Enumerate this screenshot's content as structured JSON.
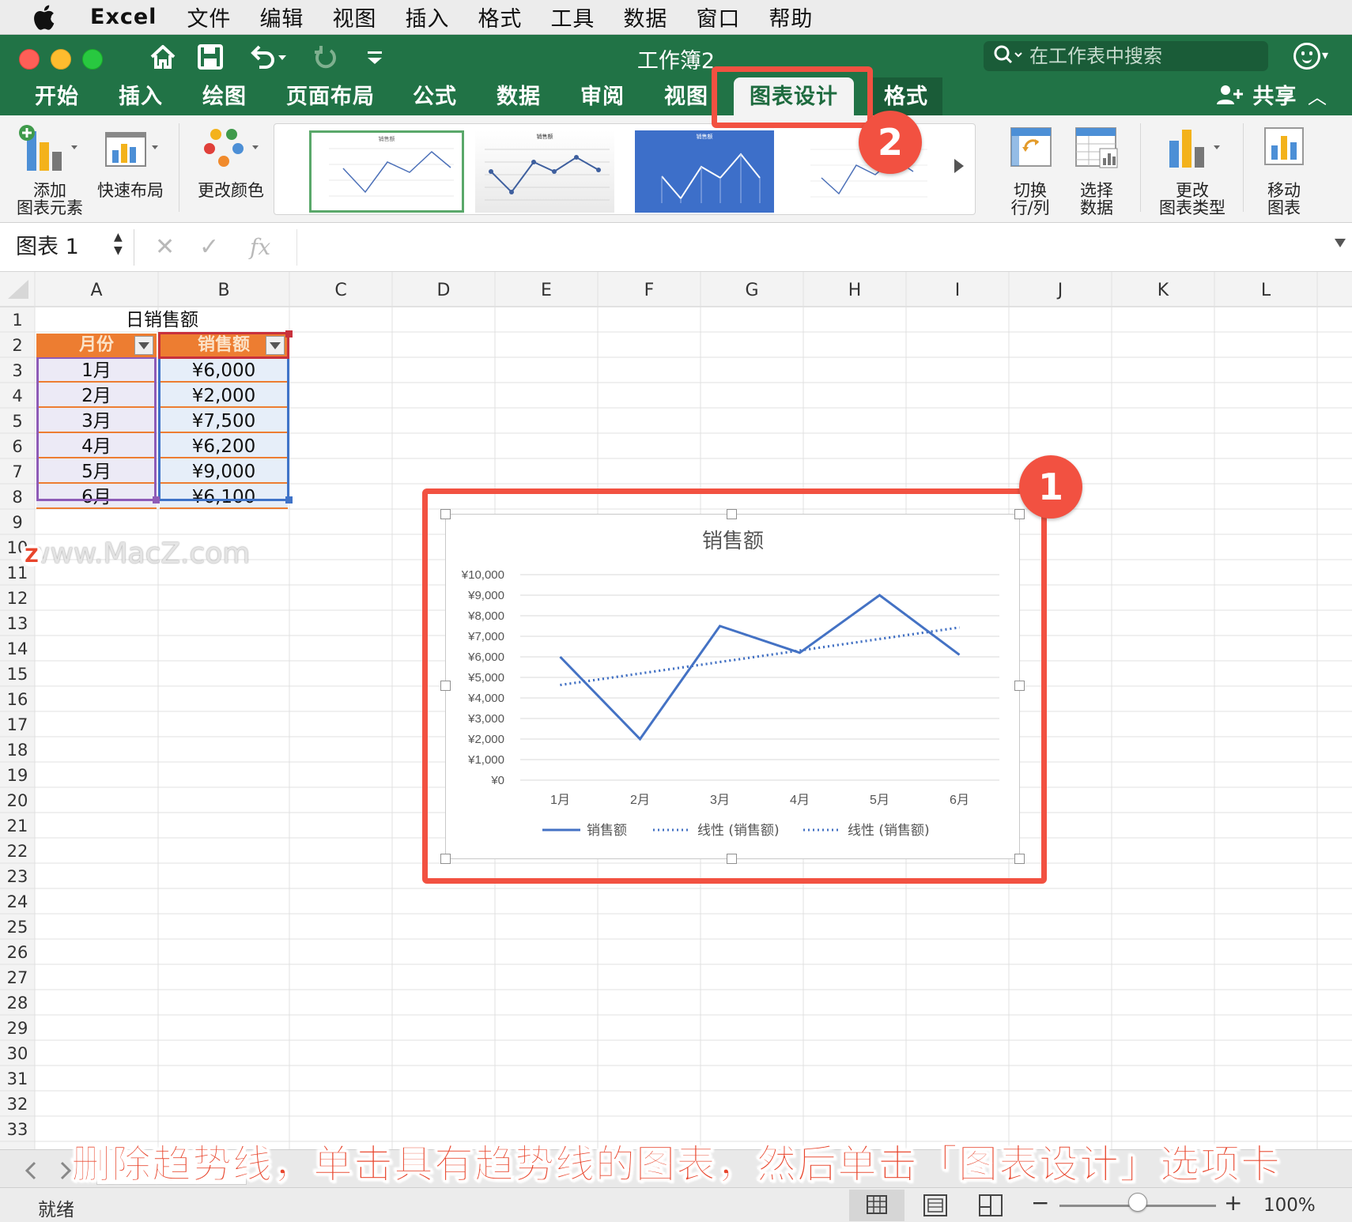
{
  "menubar": {
    "items": [
      "Excel",
      "文件",
      "编辑",
      "视图",
      "插入",
      "格式",
      "工具",
      "数据",
      "窗口",
      "帮助"
    ]
  },
  "titlebar": {
    "doc_title": "工作簿2",
    "search_placeholder": "在工作表中搜索"
  },
  "ribbon_tabs": [
    "开始",
    "插入",
    "绘图",
    "页面布局",
    "公式",
    "数据",
    "审阅",
    "视图",
    "图表设计",
    "格式"
  ],
  "ribbon_active_tab": "图表设计",
  "share_label": "共享",
  "ribbon": {
    "add_element": [
      "添加",
      "图表元素"
    ],
    "quick_layout": "快速布局",
    "change_colors": "更改颜色",
    "switch_rowcol": [
      "切换",
      "行/列"
    ],
    "select_data": [
      "选择",
      "数据"
    ],
    "change_type": [
      "更改",
      "图表类型"
    ],
    "move_chart": [
      "移动",
      "图表"
    ],
    "style_thumbnail_title": "销售额"
  },
  "formula_bar": {
    "name_box": "图表 1",
    "fx": "fx"
  },
  "columns": [
    "A",
    "B",
    "C",
    "D",
    "E",
    "F",
    "G",
    "H",
    "I",
    "J",
    "K",
    "L"
  ],
  "rows": [
    "1",
    "2",
    "3",
    "4",
    "5",
    "6",
    "7",
    "8",
    "9",
    "10",
    "11",
    "12",
    "13",
    "14",
    "15",
    "16",
    "17",
    "18",
    "19",
    "20",
    "21",
    "22",
    "23",
    "24",
    "25",
    "26",
    "27",
    "28",
    "29",
    "30",
    "31",
    "32",
    "33"
  ],
  "sheet": {
    "title": "日销售额",
    "headers": [
      "月份",
      "销售额"
    ],
    "data": [
      [
        "1月",
        "¥6,000"
      ],
      [
        "2月",
        "¥2,000"
      ],
      [
        "3月",
        "¥7,500"
      ],
      [
        "4月",
        "¥6,200"
      ],
      [
        "5月",
        "¥9,000"
      ],
      [
        "6月",
        "¥6,100"
      ]
    ]
  },
  "chart_data": {
    "type": "line",
    "title": "销售额",
    "categories": [
      "1月",
      "2月",
      "3月",
      "4月",
      "5月",
      "6月"
    ],
    "series": [
      {
        "name": "销售额",
        "values": [
          6000,
          2000,
          7500,
          6200,
          9000,
          6100
        ],
        "style": "solid",
        "color": "#4472c4"
      },
      {
        "name": "线性 (销售额)",
        "values": [
          4629,
          5189,
          5749,
          6309,
          6869,
          7429
        ],
        "style": "dotted",
        "color": "#4472c4"
      },
      {
        "name": "线性 (销售额)",
        "values": [
          4629,
          5189,
          5749,
          6309,
          6869,
          7429
        ],
        "style": "dotted",
        "color": "#4472c4"
      }
    ],
    "y_ticks": [
      "¥0",
      "¥1,000",
      "¥2,000",
      "¥3,000",
      "¥4,000",
      "¥5,000",
      "¥6,000",
      "¥7,000",
      "¥8,000",
      "¥9,000",
      "¥10,000"
    ],
    "ylim": [
      0,
      10000
    ],
    "grid": true,
    "legend": "bottom",
    "xlabel": "",
    "ylabel": ""
  },
  "watermark": "www.MacZ.com",
  "annotations": {
    "badge_1": "1",
    "badge_2": "2",
    "caption": "删除趋势线，单击具有趋势线的图表，然后单击「图表设计」选项卡"
  },
  "status": {
    "text": "就绪",
    "zoom": "100%",
    "zoom_value": 100
  },
  "colors": {
    "ribbon_green": "#217346",
    "table_header": "#ed7d31",
    "series": "#4472c4",
    "annotation_red": "#f25141"
  }
}
